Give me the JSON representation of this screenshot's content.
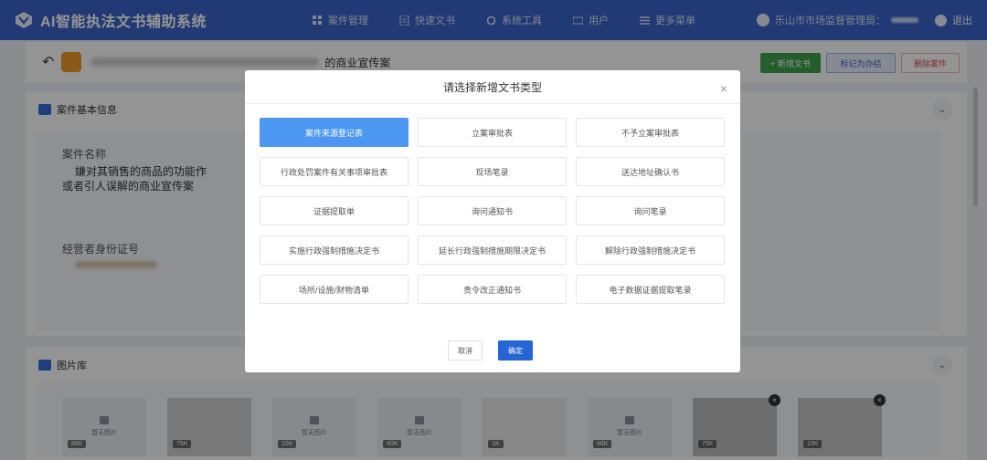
{
  "app": {
    "title": "AI智能执法文书辅助系统"
  },
  "nav": [
    {
      "label": "案件管理",
      "icon": "grid-icon"
    },
    {
      "label": "快速文书",
      "icon": "document-icon"
    },
    {
      "label": "系统工具",
      "icon": "tools-icon"
    },
    {
      "label": "用户",
      "icon": "user-icon"
    },
    {
      "label": "更多菜单",
      "icon": "menu-icon"
    }
  ],
  "user": {
    "org": "乐山市市场监督管理局：",
    "logout": "退出"
  },
  "case": {
    "title_suffix": "的商业宣传案"
  },
  "actions": {
    "new_doc": "+ 新增文书",
    "mark_done": "标记为办结",
    "delete_case": "删除案件"
  },
  "info_panel": {
    "title": "案件基本信息",
    "case_name_label": "案件名称",
    "case_name_value_line1": "嫌对其销售的商品的功能作",
    "case_name_value_line2": "或者引人误解的商业宣传案",
    "id_label": "经营者身份证号"
  },
  "gallery_panel": {
    "title": "图片库",
    "placeholder": "暂无图片",
    "thumbs": [
      {
        "type": "placeholder",
        "size": "86K"
      },
      {
        "type": "image",
        "size": "75K"
      },
      {
        "type": "placeholder",
        "size": "15K"
      },
      {
        "type": "placeholder",
        "size": "40K"
      },
      {
        "type": "image",
        "size": "1K"
      },
      {
        "type": "placeholder",
        "size": "86K"
      },
      {
        "type": "image",
        "size": "75K"
      },
      {
        "type": "image",
        "size": "15K"
      }
    ]
  },
  "modal": {
    "title": "请选择新增文书类型",
    "types": [
      "案件来源登记表",
      "立案审批表",
      "不予立案审批表",
      "行政处罚案件有关事项审批表",
      "现场笔录",
      "送达地址确认书",
      "证据提取单",
      "询问通知书",
      "询问笔录",
      "实施行政强制措施决定书",
      "延长行政强制措施期限决定书",
      "解除行政强制措施决定书",
      "场所/设施/财物清单",
      "责令改正通知书",
      "电子数据证据提取笔录"
    ],
    "selected_index": 0,
    "cancel": "取消",
    "ok": "确定"
  },
  "colors": {
    "header": "#3a63c9",
    "primary": "#2565d6",
    "selected": "#4c97f2",
    "success": "#3fa34d"
  }
}
